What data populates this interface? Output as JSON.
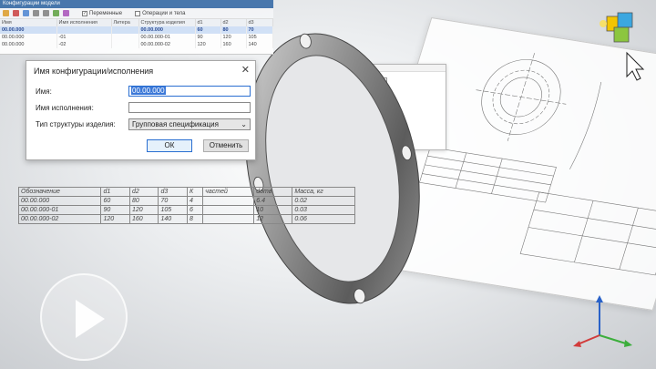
{
  "config_window": {
    "title": "Конфигурации модели",
    "toolbar": {
      "variables_label": "Переменные",
      "operations_label": "Операции и тела"
    },
    "columns": [
      "Имя",
      "Имя исполнения",
      "Литера",
      "Структура изделия",
      "d1",
      "d2",
      "d3"
    ],
    "rows": [
      {
        "name": "00.00.000",
        "exec": "",
        "litera": "",
        "structure": "00.00.000",
        "d1": "60",
        "d2": "80",
        "d3": "70"
      },
      {
        "name": "00.00.000",
        "exec": "-01",
        "litera": "",
        "structure": "00.00.000-01",
        "d1": "90",
        "d2": "120",
        "d3": "105"
      },
      {
        "name": "00.00.000",
        "exec": "-02",
        "litera": "",
        "structure": "00.00.000-02",
        "d1": "120",
        "d2": "160",
        "d3": "140"
      }
    ]
  },
  "dialog": {
    "title": "Имя конфигурации/исполнения",
    "name_label": "Имя:",
    "name_value": "00.00.000",
    "exec_label": "Имя исполнения:",
    "exec_value": "",
    "structure_label": "Тип структуры изделия:",
    "structure_value": "Групповая спецификация",
    "ok_label": "ОК",
    "cancel_label": "Отменить"
  },
  "data_table": {
    "headers": [
      "Обозначение",
      "d1",
      "d2",
      "d3",
      "К",
      "частей",
      "dотв",
      "Масса, кг"
    ],
    "rows": [
      [
        "00.00.000",
        "60",
        "80",
        "70",
        "4",
        "",
        "6.4",
        "0.02"
      ],
      [
        "00.00.000-01",
        "90",
        "120",
        "105",
        "6",
        "",
        "10",
        "0.03"
      ],
      [
        "00.00.000-02",
        "120",
        "160",
        "140",
        "8",
        "",
        "12",
        "0.06"
      ]
    ]
  },
  "colors": {
    "accent": "#2a6fd1",
    "selection": "#cfe0f7",
    "title_bar": "#3b6ea8"
  },
  "icons": [
    "play-icon",
    "kompas-logo-icon",
    "cursor-icon",
    "axes-icon",
    "close-icon",
    "chevron-down-icon"
  ]
}
